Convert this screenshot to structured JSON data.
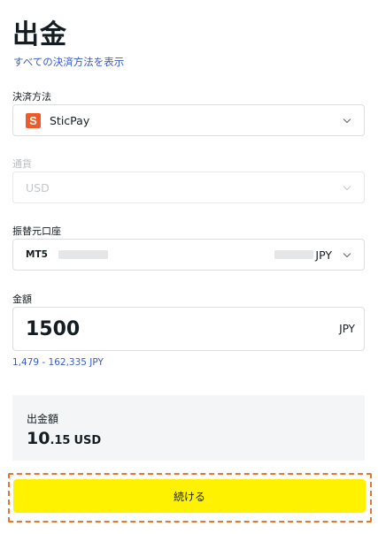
{
  "page": {
    "title": "出金",
    "all_methods_link": "すべての決済方法を表示"
  },
  "payment_method": {
    "label": "決済方法",
    "value": "SticPay",
    "logo_letter": "S",
    "logo_color": "#f05a28"
  },
  "currency": {
    "label": "通貨",
    "value": "USD"
  },
  "source_account": {
    "label": "振替元口座",
    "platform": "MT5",
    "currency": "JPY"
  },
  "amount": {
    "label": "金額",
    "value": "1500",
    "currency": "JPY",
    "range": "1,479 - 162,335 JPY"
  },
  "summary": {
    "label": "出金額",
    "amount_int": "10",
    "amount_dec": ".15",
    "currency": "USD"
  },
  "actions": {
    "continue_label": "続ける",
    "button_color": "#fff200",
    "highlight_color": "#e5782c"
  }
}
